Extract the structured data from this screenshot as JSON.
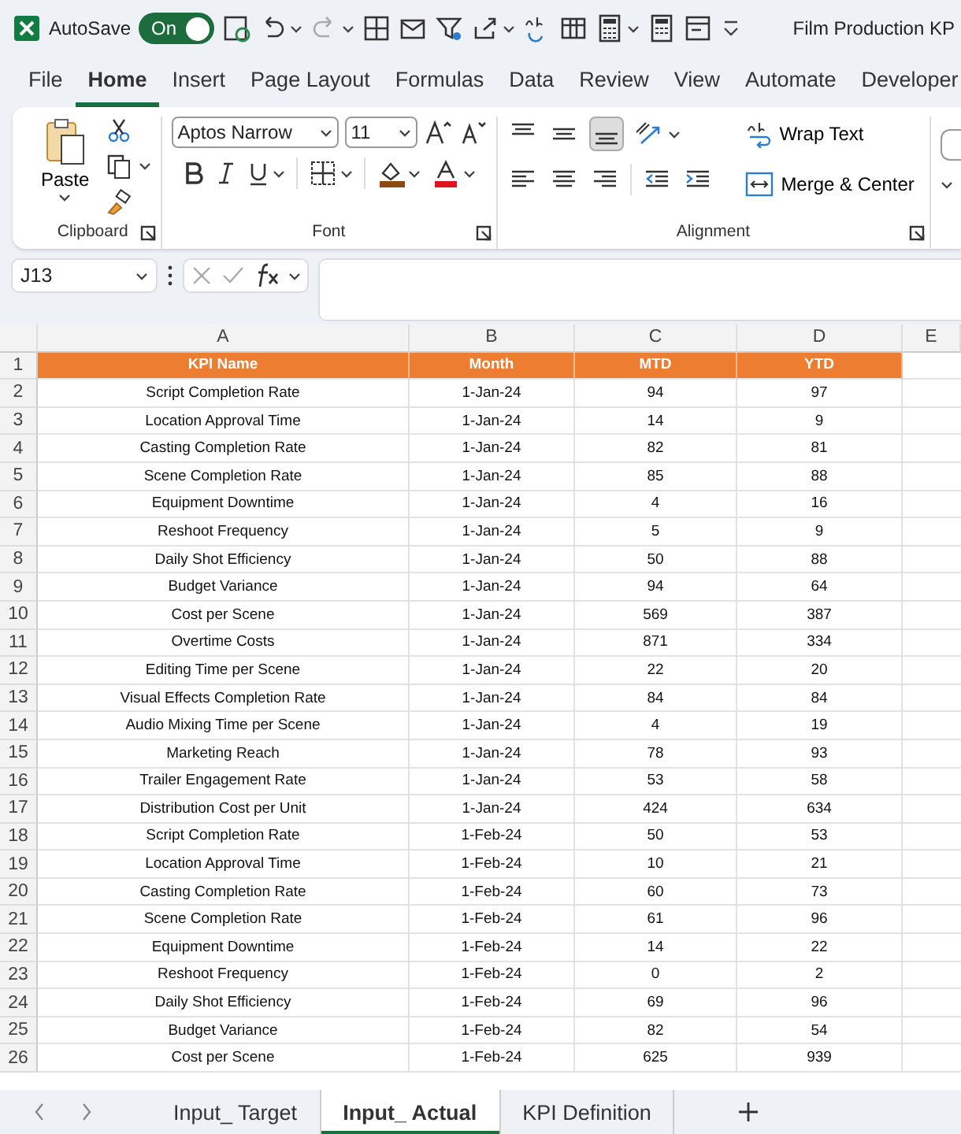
{
  "title_bar": {
    "autosave_label": "AutoSave",
    "autosave": {
      "label": "On",
      "on": true
    },
    "title": "Film Production KP"
  },
  "menu_tabs": [
    {
      "label": "File",
      "selected": false
    },
    {
      "label": "Home",
      "selected": true
    },
    {
      "label": "Insert",
      "selected": false
    },
    {
      "label": "Page Layout",
      "selected": false
    },
    {
      "label": "Formulas",
      "selected": false
    },
    {
      "label": "Data",
      "selected": false
    },
    {
      "label": "Review",
      "selected": false
    },
    {
      "label": "View",
      "selected": false
    },
    {
      "label": "Automate",
      "selected": false
    },
    {
      "label": "Developer",
      "selected": false
    }
  ],
  "ribbon": {
    "clipboard": {
      "paste_label": "Paste",
      "group_label": "Clipboard"
    },
    "font": {
      "font_name": "Aptos Narrow",
      "font_size": "11",
      "group_label": "Font"
    },
    "alignment": {
      "wrap_text": "Wrap Text",
      "merge_center": "Merge & Center",
      "group_label": "Alignment"
    }
  },
  "formula_bar": {
    "name_box": "J13"
  },
  "sheet": {
    "column_headers": [
      "A",
      "B",
      "C",
      "D",
      "E"
    ],
    "header_row": {
      "row_number": "1",
      "cells": [
        "KPI Name",
        "Month",
        "MTD",
        "YTD"
      ]
    },
    "rows": [
      {
        "row_number": "2",
        "cells": [
          "Script Completion Rate",
          "1-Jan-24",
          "94",
          "97"
        ]
      },
      {
        "row_number": "3",
        "cells": [
          "Location Approval Time",
          "1-Jan-24",
          "14",
          "9"
        ]
      },
      {
        "row_number": "4",
        "cells": [
          "Casting Completion Rate",
          "1-Jan-24",
          "82",
          "81"
        ]
      },
      {
        "row_number": "5",
        "cells": [
          "Scene Completion Rate",
          "1-Jan-24",
          "85",
          "88"
        ]
      },
      {
        "row_number": "6",
        "cells": [
          "Equipment Downtime",
          "1-Jan-24",
          "4",
          "16"
        ]
      },
      {
        "row_number": "7",
        "cells": [
          "Reshoot Frequency",
          "1-Jan-24",
          "5",
          "9"
        ]
      },
      {
        "row_number": "8",
        "cells": [
          "Daily Shot Efficiency",
          "1-Jan-24",
          "50",
          "88"
        ]
      },
      {
        "row_number": "9",
        "cells": [
          "Budget Variance",
          "1-Jan-24",
          "94",
          "64"
        ]
      },
      {
        "row_number": "10",
        "cells": [
          "Cost per Scene",
          "1-Jan-24",
          "569",
          "387"
        ]
      },
      {
        "row_number": "11",
        "cells": [
          "Overtime Costs",
          "1-Jan-24",
          "871",
          "334"
        ]
      },
      {
        "row_number": "12",
        "cells": [
          "Editing Time per Scene",
          "1-Jan-24",
          "22",
          "20"
        ]
      },
      {
        "row_number": "13",
        "cells": [
          "Visual Effects Completion Rate",
          "1-Jan-24",
          "84",
          "84"
        ]
      },
      {
        "row_number": "14",
        "cells": [
          "Audio Mixing Time per Scene",
          "1-Jan-24",
          "4",
          "19"
        ]
      },
      {
        "row_number": "15",
        "cells": [
          "Marketing Reach",
          "1-Jan-24",
          "78",
          "93"
        ]
      },
      {
        "row_number": "16",
        "cells": [
          "Trailer Engagement Rate",
          "1-Jan-24",
          "53",
          "58"
        ]
      },
      {
        "row_number": "17",
        "cells": [
          "Distribution Cost per Unit",
          "1-Jan-24",
          "424",
          "634"
        ]
      },
      {
        "row_number": "18",
        "cells": [
          "Script Completion Rate",
          "1-Feb-24",
          "50",
          "53"
        ]
      },
      {
        "row_number": "19",
        "cells": [
          "Location Approval Time",
          "1-Feb-24",
          "10",
          "21"
        ]
      },
      {
        "row_number": "20",
        "cells": [
          "Casting Completion Rate",
          "1-Feb-24",
          "60",
          "73"
        ]
      },
      {
        "row_number": "21",
        "cells": [
          "Scene Completion Rate",
          "1-Feb-24",
          "61",
          "96"
        ]
      },
      {
        "row_number": "22",
        "cells": [
          "Equipment Downtime",
          "1-Feb-24",
          "14",
          "22"
        ]
      },
      {
        "row_number": "23",
        "cells": [
          "Reshoot Frequency",
          "1-Feb-24",
          "0",
          "2"
        ]
      },
      {
        "row_number": "24",
        "cells": [
          "Daily Shot Efficiency",
          "1-Feb-24",
          "69",
          "96"
        ]
      },
      {
        "row_number": "25",
        "cells": [
          "Budget Variance",
          "1-Feb-24",
          "82",
          "54"
        ]
      },
      {
        "row_number": "26",
        "cells": [
          "Cost per Scene",
          "1-Feb-24",
          "625",
          "939"
        ]
      }
    ]
  },
  "sheet_tabs": [
    {
      "label": "Input_ Target",
      "selected": false
    },
    {
      "label": "Input_ Actual",
      "selected": true
    },
    {
      "label": "KPI Definition",
      "selected": false
    }
  ]
}
